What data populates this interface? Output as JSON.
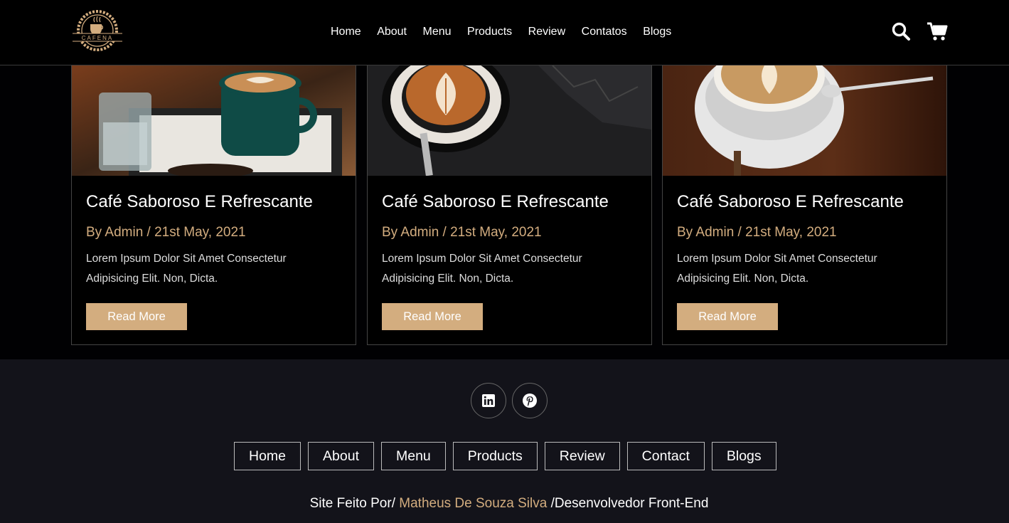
{
  "header": {
    "logo_text": "CAFENA",
    "nav": [
      "Home",
      "About",
      "Menu",
      "Products",
      "Review",
      "Contatos",
      "Blogs"
    ],
    "icons": [
      "search-icon",
      "cart-icon"
    ]
  },
  "blogs": [
    {
      "title": "Café Saboroso E Refrescante",
      "meta": "By Admin / 21st May, 2021",
      "desc": "Lorem Ipsum Dolor Sit Amet Consectetur Adipisicing Elit. Non, Dicta.",
      "button": "Read More"
    },
    {
      "title": "Café Saboroso E Refrescante",
      "meta": "By Admin / 21st May, 2021",
      "desc": "Lorem Ipsum Dolor Sit Amet Consectetur Adipisicing Elit. Non, Dicta.",
      "button": "Read More"
    },
    {
      "title": "Café Saboroso E Refrescante",
      "meta": "By Admin / 21st May, 2021",
      "desc": "Lorem Ipsum Dolor Sit Amet Consectetur Adipisicing Elit. Non, Dicta.",
      "button": "Read More"
    }
  ],
  "footer": {
    "social": [
      "linkedin-icon",
      "pinterest-icon"
    ],
    "links": [
      "Home",
      "About",
      "Menu",
      "Products",
      "Review",
      "Contact",
      "Blogs"
    ],
    "credit_prefix": "Site Feito Por/ ",
    "credit_name": "Matheus De Souza Silva",
    "credit_suffix": " /Desenvolvedor Front-End"
  },
  "colors": {
    "accent": "#d3ad7f",
    "background": "#010103",
    "footer_bg": "#13131a"
  }
}
